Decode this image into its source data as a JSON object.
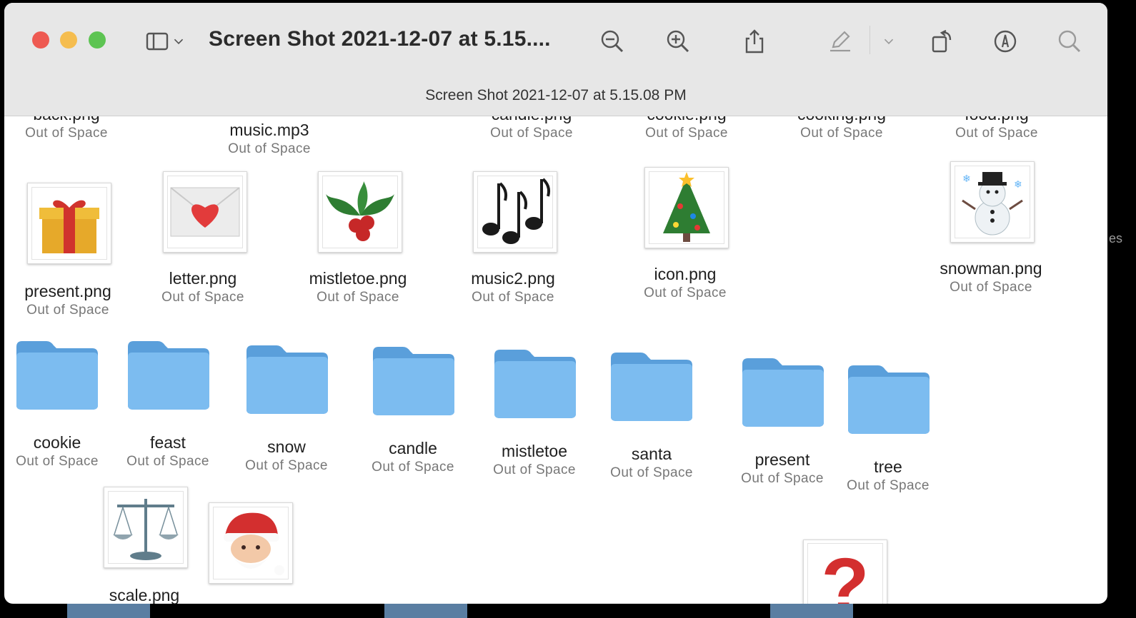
{
  "window": {
    "title": "Screen Shot 2021-12-07 at 5.15....",
    "subtitle": "Screen Shot 2021-12-07 at 5.15.08 PM",
    "toolbar_icons": [
      "sidebar-icon",
      "chevron-down-icon",
      "zoom-out-icon",
      "zoom-in-icon",
      "share-icon",
      "markup-pen-icon",
      "chevron-down-icon",
      "rotate-icon",
      "annotate-icon",
      "search-icon"
    ]
  },
  "top_row": [
    {
      "name": "back.png",
      "status": "Out of Space"
    },
    {
      "name": "music.mp3",
      "status": "Out of Space"
    },
    {
      "name": "candle.png",
      "status": "Out of Space"
    },
    {
      "name": "cookie.png",
      "status": "Out of Space"
    },
    {
      "name": "cooking.png",
      "status": "Out of Space"
    },
    {
      "name": "food.png",
      "status": "Out of Space"
    }
  ],
  "images": [
    {
      "name": "present.png",
      "status": "Out of Space",
      "icon": "present-icon"
    },
    {
      "name": "letter.png",
      "status": "Out of Space",
      "icon": "love-letter-icon"
    },
    {
      "name": "mistletoe.png",
      "status": "Out of Space",
      "icon": "holly-icon"
    },
    {
      "name": "music2.png",
      "status": "Out of Space",
      "icon": "music-notes-icon"
    },
    {
      "name": "icon.png",
      "status": "Out of Space",
      "icon": "christmas-tree-icon"
    },
    {
      "name": "snowman.png",
      "status": "Out of Space",
      "icon": "snowman-icon"
    }
  ],
  "folders": [
    {
      "name": "cookie",
      "status": "Out of Space"
    },
    {
      "name": "feast",
      "status": "Out of Space"
    },
    {
      "name": "snow",
      "status": "Out of Space"
    },
    {
      "name": "candle",
      "status": "Out of Space"
    },
    {
      "name": "mistletoe",
      "status": "Out of Space"
    },
    {
      "name": "santa",
      "status": "Out of Space"
    },
    {
      "name": "present",
      "status": "Out of Space"
    },
    {
      "name": "tree",
      "status": "Out of Space"
    }
  ],
  "bottom": [
    {
      "name": "scale.png",
      "icon": "scale-icon"
    },
    {
      "name": "",
      "icon": "santa-icon"
    },
    {
      "name": "",
      "icon": "question-mark-icon"
    }
  ],
  "edge_text": [
    "es"
  ],
  "colors": {
    "folder": "#7cbcf0",
    "folder_tab": "#5a9fdb",
    "close": "#ee5a52",
    "minimize": "#f5bd4f",
    "zoom": "#5dc452"
  }
}
